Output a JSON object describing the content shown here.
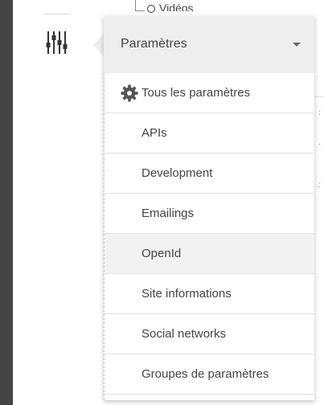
{
  "background": {
    "tree_item_label": "Vidéos",
    "right_marks": [
      ":",
      ".",
      ".:"
    ]
  },
  "rail": {
    "settings_icon": "sliders-icon"
  },
  "menu": {
    "title": "Paramètres",
    "caret_icon": "caret-down-icon",
    "items": [
      {
        "label": "Tous les paramètres",
        "icon": "gear-icon"
      },
      {
        "label": "APIs"
      },
      {
        "label": "Development"
      },
      {
        "label": "Emailings"
      },
      {
        "label": "OpenId",
        "highlighted": true
      },
      {
        "label": "Site informations"
      },
      {
        "label": "Social networks"
      },
      {
        "label": "Groupes de paramètres"
      }
    ]
  },
  "colors": {
    "left_bar": "#444444",
    "header_bg": "#eeeeee",
    "highlight_bg": "#f2f2f2",
    "icon": "#555555"
  }
}
